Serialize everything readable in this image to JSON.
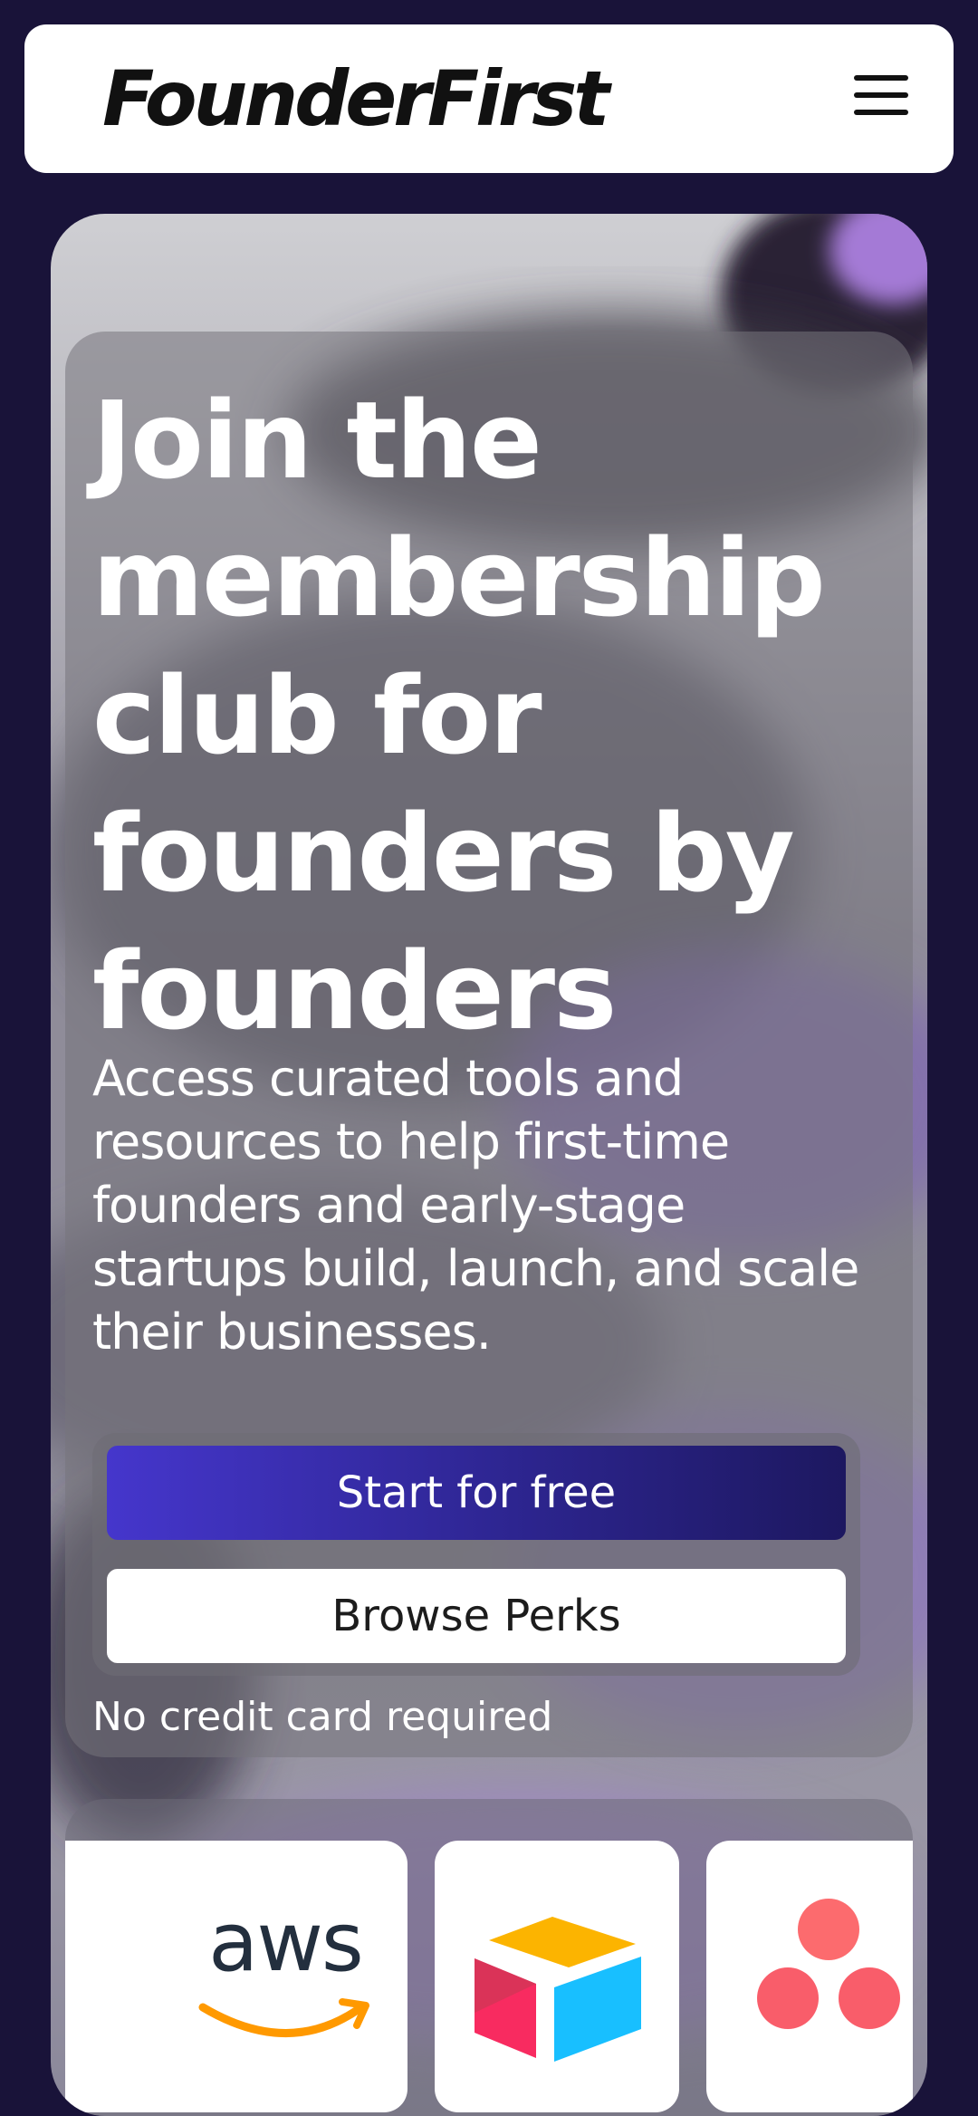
{
  "nav": {
    "brand": "FounderFirst",
    "menu_icon": "hamburger-menu-icon"
  },
  "hero": {
    "title": "Join the membership club for founders by founders",
    "subtitle": "Access curated tools and resources to help first-time founders and early-stage startups build, launch, and scale their businesses.",
    "primary_cta": "Start for free",
    "secondary_cta": "Browse Perks",
    "note": "No credit card required"
  },
  "partners": {
    "aws_wordmark": "aws",
    "logos": [
      "partial-logo-icon",
      "aws-logo",
      "airtable-logo-icon",
      "asana-logo-icon"
    ]
  },
  "colors": {
    "page_bg": "#191339",
    "primary_button_start": "#4536cc",
    "primary_button_end": "#1d1860",
    "aws_orange": "#ff9900",
    "aws_navy": "#232f3e",
    "asana_pink": "#f95d6a"
  }
}
